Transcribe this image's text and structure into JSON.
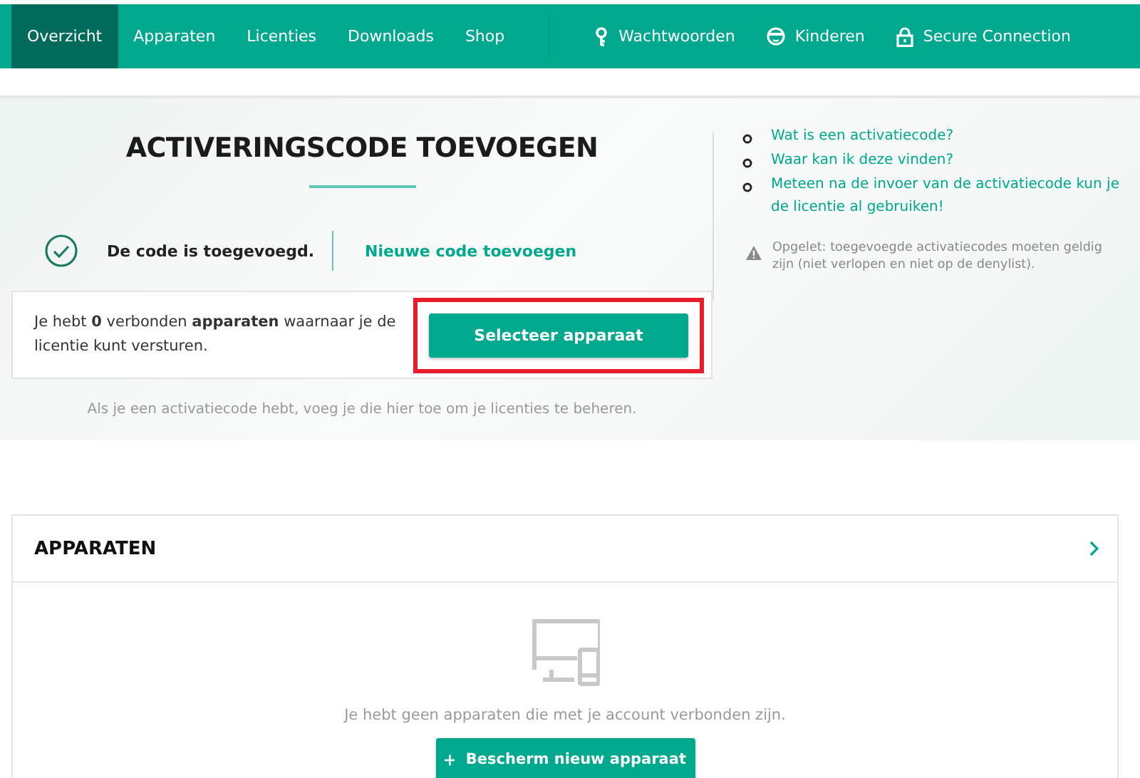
{
  "nav": {
    "tabs": [
      {
        "label": "Overzicht",
        "selected": true,
        "kind": "plain"
      },
      {
        "label": "Apparaten",
        "selected": false,
        "kind": "plain"
      },
      {
        "label": "Licenties",
        "selected": false,
        "kind": "plain"
      },
      {
        "label": "Downloads",
        "selected": false,
        "kind": "plain"
      },
      {
        "label": "Shop",
        "selected": false,
        "kind": "plain"
      },
      {
        "label": "Wachtwoorden",
        "selected": false,
        "kind": "key"
      },
      {
        "label": "Kinderen",
        "selected": false,
        "kind": "kid"
      },
      {
        "label": "Secure Connection",
        "selected": false,
        "kind": "lock"
      }
    ]
  },
  "activation": {
    "title": "ACTIVERINGSCODE TOEVOEGEN",
    "status": "De code is toegevoegd.",
    "new_code_link": "Nieuwe code toevoegen",
    "devices_message": "Je hebt **0** verbonden **apparaten** waarnaar je de licentie kunt versturen.",
    "select_button": "Selecteer apparaat",
    "highlighted": true,
    "hint": "Als je een activatiecode hebt, voeg je die hier toe om je licenties te beheren."
  },
  "help": {
    "links": [
      "Wat is een activatiecode?",
      "Waar kan ik deze vinden?",
      "Meteen na de invoer van de activatiecode kun je de licentie al gebruiken!"
    ],
    "warning": "Opgelet: toegevoegde activatiecodes moeten geldig zijn (niet verlopen en niet op de denylist)."
  },
  "devices": {
    "title": "APPARATEN",
    "empty_message": "Je hebt geen apparaten die met je account verbonden zijn.",
    "add_button": "Bescherm nieuw apparaat"
  }
}
